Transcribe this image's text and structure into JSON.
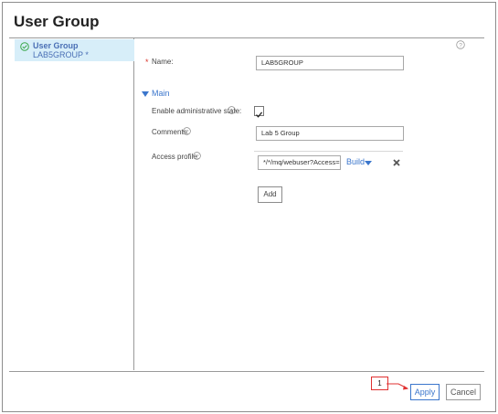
{
  "window": {
    "title": "User Group"
  },
  "sidebar": {
    "item_title": "User Group",
    "item_subtitle": "LAB5GROUP *",
    "status_icon": "check-circle-icon"
  },
  "help_icon": "question-circle-icon",
  "form": {
    "name": {
      "label": "Name:",
      "required_marker": "*",
      "value": "LAB5GROUP"
    },
    "section": {
      "label": "Main",
      "expanded": true
    },
    "enable_admin_state": {
      "label": "Enable administrative state:",
      "checked": true
    },
    "comments": {
      "label": "Comments:",
      "value": "Lab 5 Group"
    },
    "access_profile": {
      "label": "Access profile:",
      "value": "*/*/mq/webuser?Access=r",
      "build_label": "Build",
      "add_label": "Add"
    }
  },
  "footer": {
    "callout_number": "1",
    "apply_label": "Apply",
    "cancel_label": "Cancel"
  },
  "colors": {
    "accent": "#3b76cc",
    "selection": "#d7eef9",
    "callout": "#e03030"
  }
}
